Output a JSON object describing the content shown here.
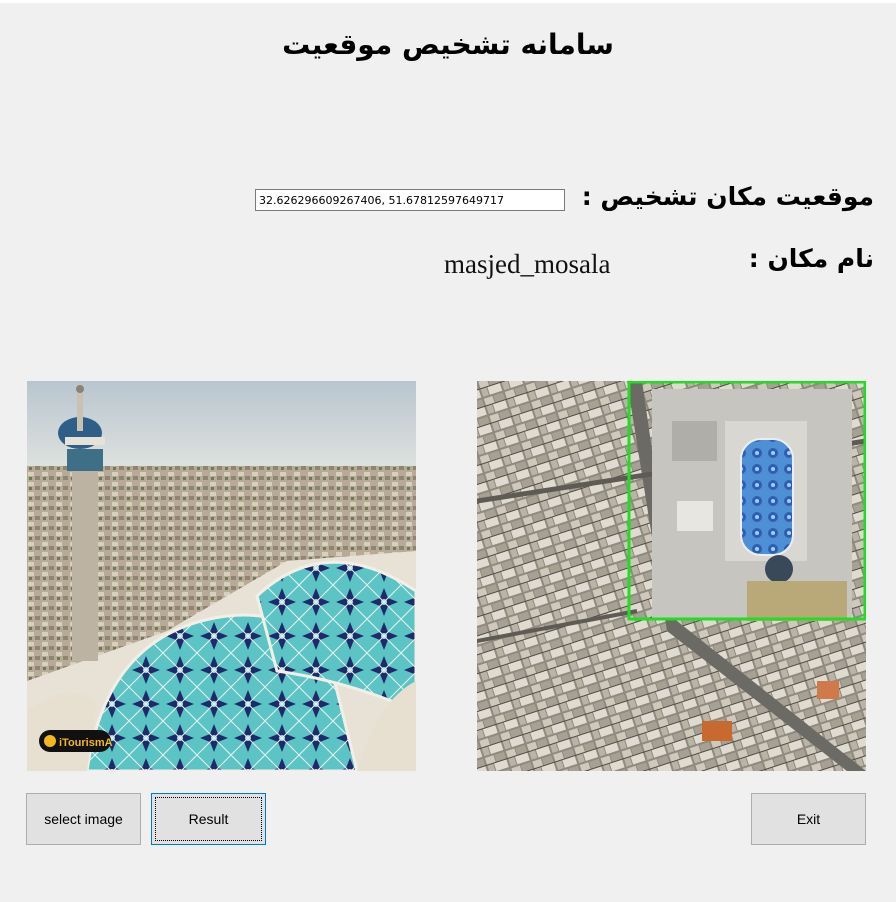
{
  "app": {
    "title": "سامانه تشخیص موقعیت"
  },
  "detection": {
    "coordinates_label": "موقعیت مکان تشخیص :",
    "coordinates_value": "32.626296609267406, 51.67812597649717",
    "place_label": "نام مکان :",
    "place_value": "masjed_mosala"
  },
  "images": {
    "input_photo": {
      "description_icon": "mosque-photo",
      "watermark": "iTourismA"
    },
    "satellite_map": {
      "description_icon": "satellite-map",
      "detection_box_color": "#1ee01e"
    }
  },
  "buttons": {
    "select_image": "select image",
    "result": "Result",
    "exit": "Exit"
  },
  "colors": {
    "window_background": "#f0f0f0",
    "button_face": "#e1e1e1",
    "focus_border": "#0078d7",
    "tile_teal": "#5cc4c4",
    "tile_navy": "#1f2a6b"
  }
}
